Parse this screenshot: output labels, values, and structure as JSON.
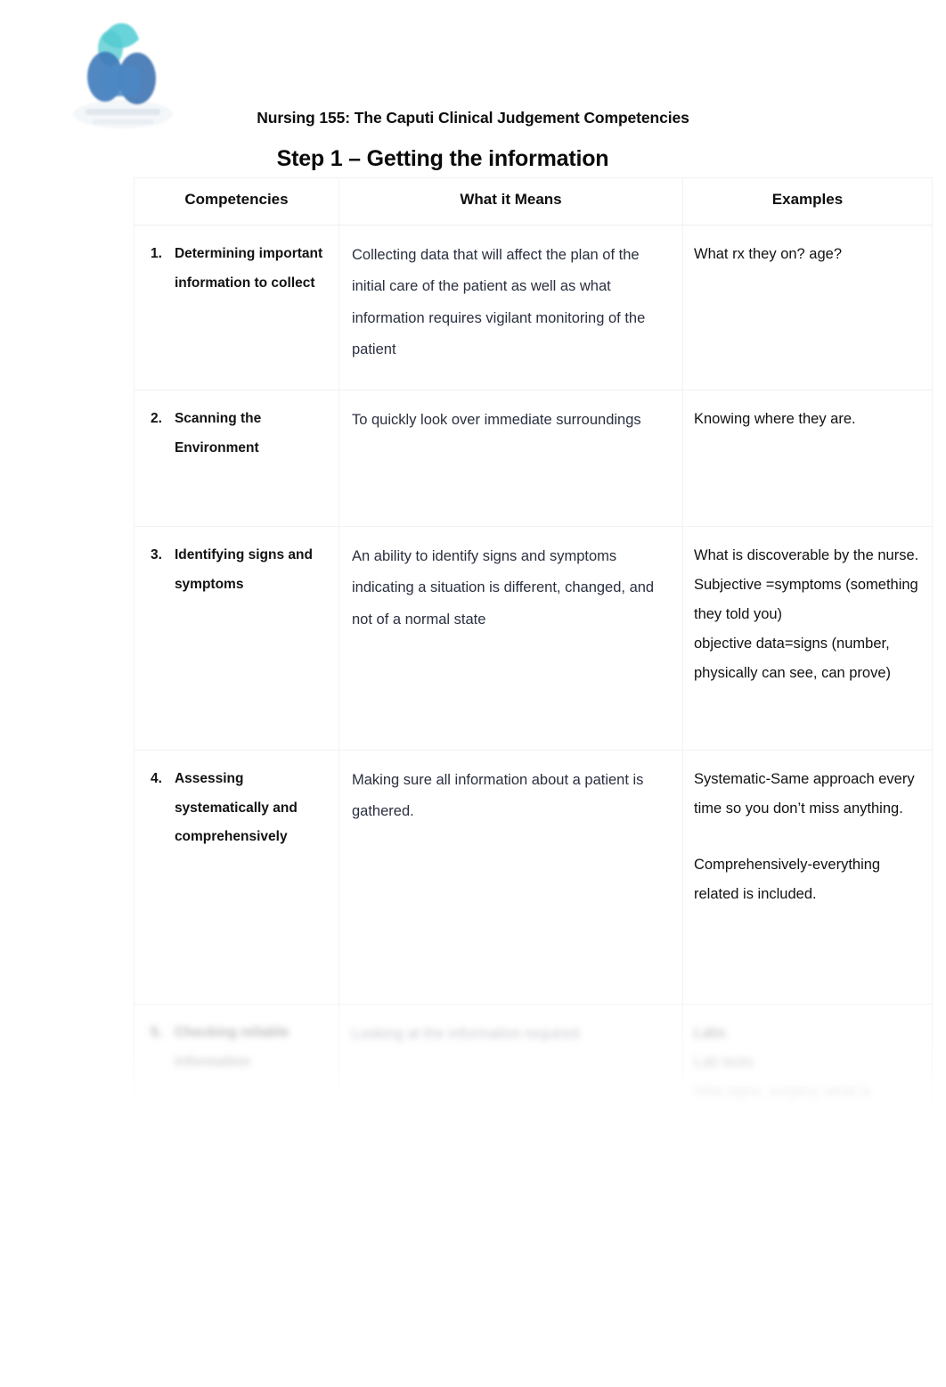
{
  "document": {
    "header_title": "Nursing 155: The Caputi Clinical Judgement Competencies",
    "step_title": "Step 1 – Getting the information",
    "logo_alt": "institution-logo"
  },
  "table": {
    "columns": [
      "Competencies",
      "What it Means",
      "Examples"
    ],
    "rows": [
      {
        "number": "1.",
        "competency": "Determining important information to collect",
        "means": "Collecting data that will affect the plan of the initial care of the patient as well as what information requires vigilant monitoring of the patient",
        "examples": [
          "What rx they on? age?"
        ]
      },
      {
        "number": "2.",
        "competency": "Scanning the Environment",
        "means": "To quickly look over immediate surroundings",
        "examples": [
          "Knowing where they are."
        ]
      },
      {
        "number": "3.",
        "competency": "Identifying signs and symptoms",
        "means": "An ability to identify signs and symptoms indicating a situation is different, changed, and not of a normal state",
        "examples": [
          " What is discoverable by the nurse.",
          "Subjective =symptoms (something they told you)",
          "objective data=signs (number, physically can see, can prove)"
        ]
      },
      {
        "number": "4.",
        "competency": "Assessing systematically and comprehensively",
        "means": "Making sure all information about a patient is gathered.",
        "examples": [
          "Systematic-Same approach every time so you don’t miss anything.",
          "Comprehensively-everything related is included."
        ]
      },
      {
        "number": "5.",
        "competency": "Checking reliable information",
        "means": "Looking at the information required",
        "examples": [
          "Labs",
          "Lab tests",
          "Vital signs, surgery, what is"
        ]
      }
    ]
  }
}
